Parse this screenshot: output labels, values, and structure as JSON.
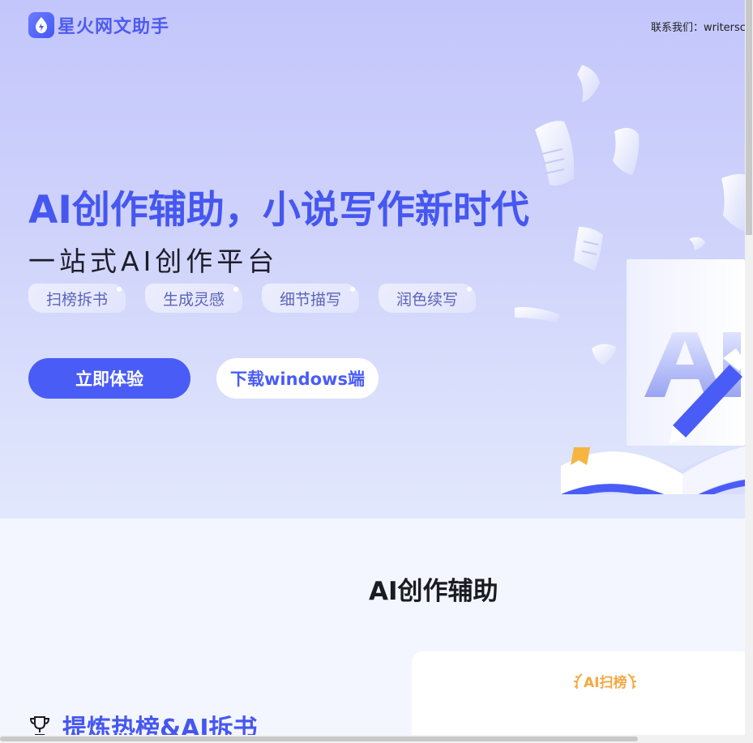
{
  "header": {
    "logo_text": "星火网文助手",
    "contact_label": "联系我们：writersc"
  },
  "hero": {
    "headline": "AI创作辅助，小说写作新时代",
    "subline": "一站式AI创作平台",
    "tags": [
      {
        "label": "扫榜拆书"
      },
      {
        "label": "生成灵感"
      },
      {
        "label": "细节描写"
      },
      {
        "label": "润色续写"
      }
    ],
    "primary_button": "立即体验",
    "secondary_button": "下载windows端"
  },
  "features": {
    "section_title": "AI创作辅助",
    "feature_heading": "提炼热榜&AI拆书",
    "card_badge": "AI扫榜"
  },
  "colors": {
    "accent": "#4a5cf6",
    "headline": "#4657f0",
    "badge": "#f3a843"
  }
}
